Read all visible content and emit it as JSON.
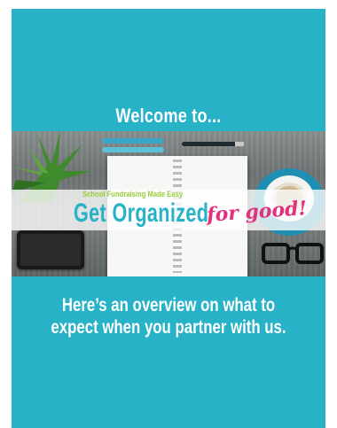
{
  "slide": {
    "welcome": "Welcome to...",
    "banner": {
      "tagline": "School Fundraising Made Easy",
      "headline": "Get Organized",
      "script": "for good!"
    },
    "overview_line1": "Here’s an overview on what to",
    "overview_line2": "expect when you partner with us."
  },
  "colors": {
    "background": "#27b2c8",
    "headline": "#27b2c8",
    "tagline": "#9ccd3a",
    "script": "#e0307e",
    "text": "#ffffff"
  },
  "icons": [
    "plant-icon",
    "pens-icon",
    "notebook-icon",
    "phone-icon",
    "coffee-cup-icon",
    "glasses-icon"
  ]
}
